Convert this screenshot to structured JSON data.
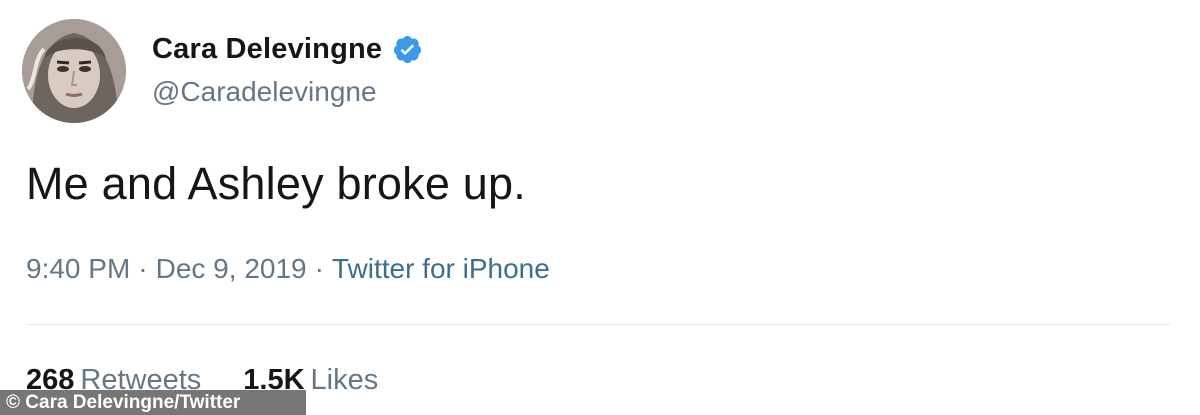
{
  "user": {
    "display_name": "Cara Delevingne",
    "handle": "@Caradelevingne",
    "verified_color": "#3a9ae8"
  },
  "tweet": {
    "text": "Me and Ashley broke up.",
    "time": "9:40 PM",
    "date": "Dec 9, 2019",
    "separator": "·",
    "source": "Twitter for iPhone"
  },
  "stats": {
    "retweets_count": "268",
    "retweets_label": "Retweets",
    "likes_count": "1.5K",
    "likes_label": "Likes"
  },
  "credit": "© Cara Delevingne/Twitter"
}
